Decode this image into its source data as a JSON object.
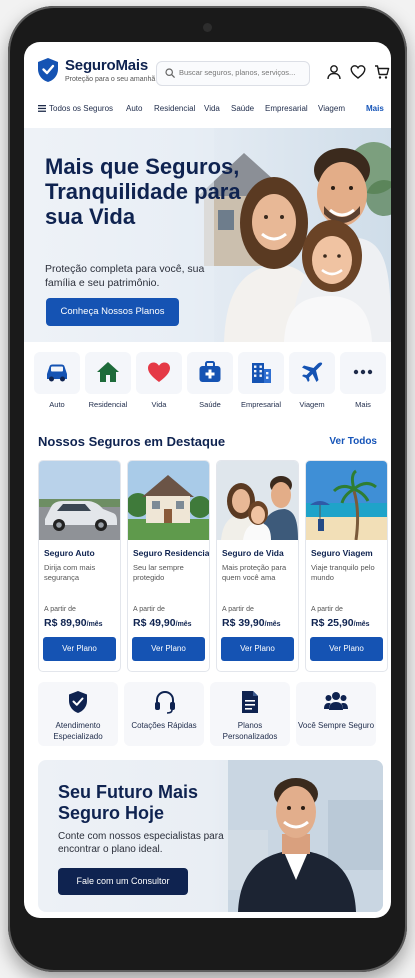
{
  "header": {
    "brand": "SeguroMais",
    "tagline": "Proteção para o seu amanhã",
    "search_placeholder": "Buscar seguros, planos, serviços..."
  },
  "nav": {
    "all_label": "Todos os Seguros",
    "items": [
      "Auto",
      "Residencial",
      "Vida",
      "Saúde",
      "Empresarial",
      "Viagem"
    ],
    "more_label": "Mais"
  },
  "hero": {
    "title": "Mais que Seguros, Tranquilidade para sua Vida",
    "subtitle": "Proteção completa para você, sua família e seu patrimônio.",
    "button": "Conheça Nossos Planos"
  },
  "categories": [
    {
      "label": "Auto",
      "icon": "car-icon"
    },
    {
      "label": "Residencial",
      "icon": "house-icon"
    },
    {
      "label": "Vida",
      "icon": "heart-icon"
    },
    {
      "label": "Saúde",
      "icon": "medical-kit-icon"
    },
    {
      "label": "Empresarial",
      "icon": "building-icon"
    },
    {
      "label": "Viagem",
      "icon": "airplane-icon"
    },
    {
      "label": "Mais",
      "icon": "more-dots-icon"
    }
  ],
  "featured": {
    "title": "Nossos Seguros em Destaque",
    "see_all": "Ver Todos",
    "cards": [
      {
        "title": "Seguro Auto",
        "desc": "Dirija com mais segurança",
        "from": "A partir de",
        "price": "R$ 89,90",
        "period": "/mês",
        "button": "Ver Plano"
      },
      {
        "title": "Seguro Residencial",
        "desc": "Seu lar sempre protegido",
        "from": "A partir de",
        "price": "R$ 49,90",
        "period": "/mês",
        "button": "Ver Plano"
      },
      {
        "title": "Seguro de Vida",
        "desc": "Mais proteção para quem você ama",
        "from": "A partir de",
        "price": "R$ 39,90",
        "period": "/mês",
        "button": "Ver Plano"
      },
      {
        "title": "Seguro Viagem",
        "desc": "Viaje tranquilo pelo mundo",
        "from": "A partir de",
        "price": "R$ 25,90",
        "period": "/mês",
        "button": "Ver Plano"
      }
    ]
  },
  "features": [
    {
      "label": "Atendimento Especializado",
      "icon": "shield-check-icon"
    },
    {
      "label": "Cotações Rápidas",
      "icon": "headset-icon"
    },
    {
      "label": "Planos Personalizados",
      "icon": "document-icon"
    },
    {
      "label": "Você Sempre Seguro",
      "icon": "people-icon"
    }
  ],
  "banner": {
    "title": "Seu Futuro Mais Seguro Hoje",
    "subtitle": "Conte com nossos especialistas para encontrar o plano ideal.",
    "button": "Fale com um Consultor"
  },
  "colors": {
    "primary": "#1553b3",
    "navy": "#0f2350",
    "accent_red": "#e53946",
    "accent_green": "#1e6b3a"
  }
}
